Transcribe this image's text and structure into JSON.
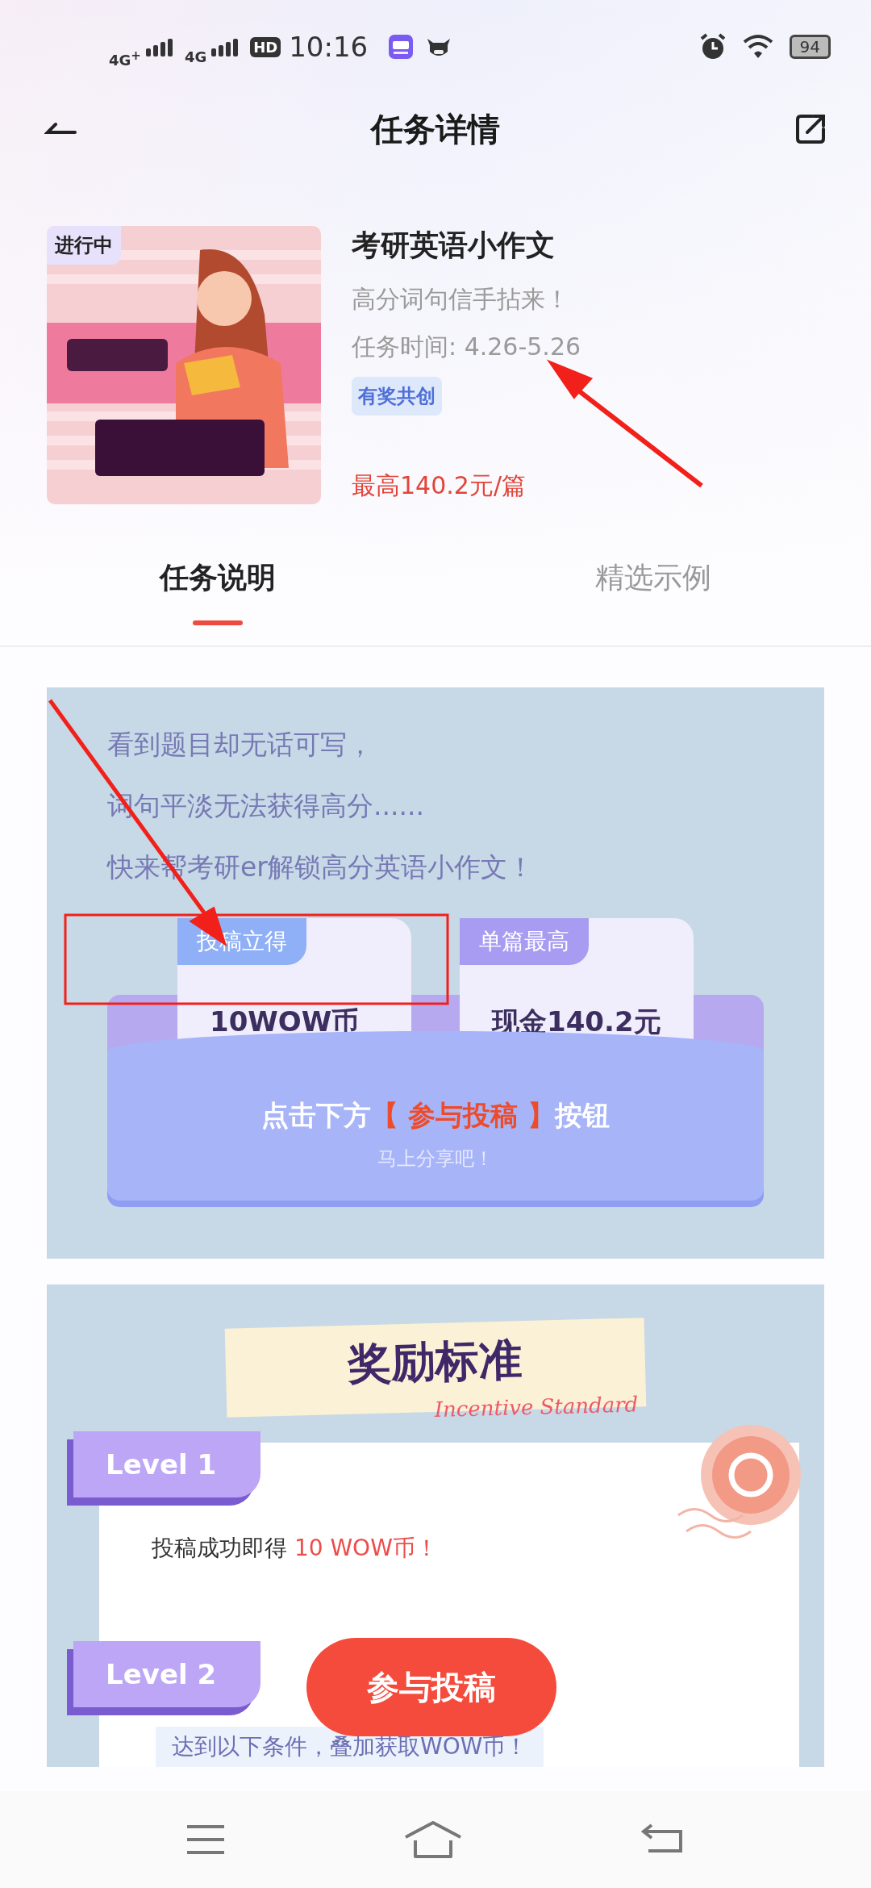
{
  "status_bar": {
    "signal_1": "4G$^{+}$",
    "signal_2": "4G",
    "hd": "HD",
    "time": "10:16",
    "battery": "94"
  },
  "header": {
    "title": "任务详情"
  },
  "task": {
    "status_badge": "进行中",
    "title": "考研英语小作文",
    "subtitle": "高分词句信手拈来！",
    "time": "任务时间: 4.26-5.26",
    "tag": "有奖共创",
    "reward": "最高140.2元/篇"
  },
  "tabs": [
    {
      "label": "任务说明",
      "selected": true
    },
    {
      "label": "精选示例",
      "selected": false
    }
  ],
  "intro": {
    "lines": [
      "看到题目却无话可写，",
      "词句平淡无法获得高分......",
      "快来帮考研er解锁高分英语小作文！"
    ],
    "cards": [
      {
        "label": "投稿立得",
        "value": "10WOW币",
        "color": "#8fb0f6"
      },
      {
        "label": "单篇最高",
        "value": "现金140.2元",
        "color": "#a79bf2"
      }
    ],
    "instruction": {
      "prefix": "点击下方",
      "highlight": "【 参与投稿 】",
      "suffix": "按钮"
    },
    "sub": "马上分享吧！"
  },
  "incentive": {
    "title": "奖励标准",
    "subtitle": "Incentive Standard",
    "levels": [
      {
        "label": "Level 1",
        "text": "投稿成功即得 ",
        "highlight": "10 WOW币！"
      },
      {
        "label": "Level 2",
        "note": "达到以下条件，叠加获取WOW币！"
      }
    ]
  },
  "action_button": "参与投稿"
}
